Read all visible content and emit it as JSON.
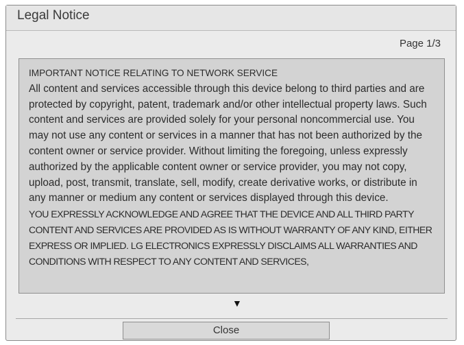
{
  "dialog": {
    "title": "Legal Notice",
    "page_indicator": "Page 1/3",
    "close_label": "Close",
    "scroll_down_glyph": "▼",
    "scroll_down_icon": "triangle-down-icon"
  },
  "notice": {
    "heading": "IMPORTANT NOTICE RELATING TO NETWORK SERVICE",
    "paragraph": "All content and services accessible through this device belong to third parties and are protected by copyright, patent, trademark and/or other intellectual property laws. Such content and services are provided solely for your personal noncommercial use. You may not use any content or services in a manner that has not been authorized by the content owner or service provider. Without limiting the foregoing, unless expressly authorized by the applicable content owner or service provider, you may not copy, upload, post, transmit, translate, sell, modify, create derivative works, or distribute in any manner or medium any content or services displayed through this device.",
    "disclaimer": "YOU EXPRESSLY ACKNOWLEDGE AND AGREE THAT THE DEVICE AND ALL THIRD PARTY CONTENT AND SERVICES ARE PROVIDED AS IS WITHOUT WARRANTY OF ANY KIND, EITHER EXPRESS OR IMPLIED. LG ELECTRONICS EXPRESSLY DISCLAIMS ALL WARRANTIES AND CONDITIONS WITH RESPECT TO ANY CONTENT AND SERVICES,"
  },
  "colors": {
    "dialog_background": "#ebebeb",
    "panel_background": "#d3d3d3",
    "border": "#8a8a8a"
  }
}
